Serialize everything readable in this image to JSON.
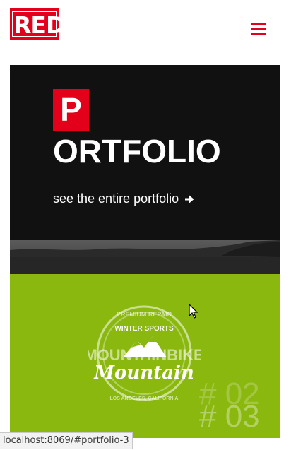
{
  "header": {
    "logo_text": "RED",
    "brand_color": "#e3001b"
  },
  "portfolio": {
    "initial": "P",
    "title_rest": "ORTFOLIO",
    "link_text": "see the entire portfolio",
    "link_icon": "arrow-right-icon"
  },
  "portfolio_item": {
    "badge_top": "PREMIUM REPAIR",
    "badge_sub": "WINTER SPORTS",
    "brand_big": "MOUNTAINBIKE",
    "brand_script": "Mountain",
    "badge_bottom": "LOS ANGELES, CALIFORNIA",
    "number_back": "# 02",
    "number_front": "# 03",
    "accent_color": "#8ab80f"
  },
  "status": {
    "url": "localhost:8069/#portfolio-3"
  }
}
